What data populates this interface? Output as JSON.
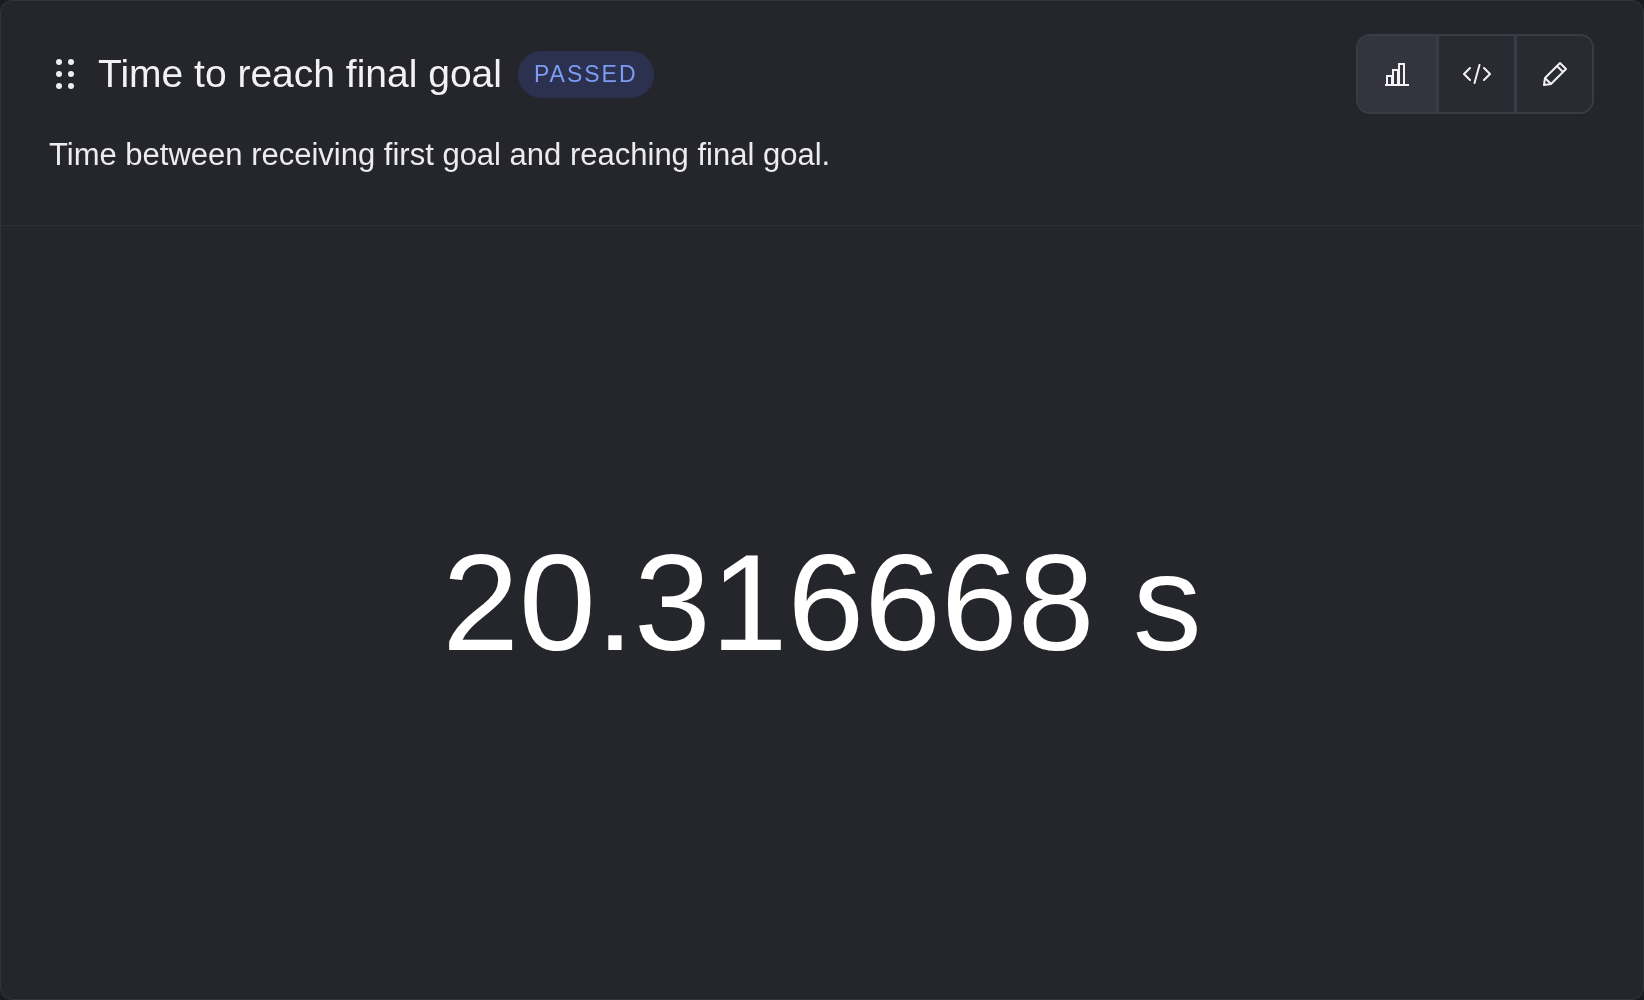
{
  "card": {
    "title": "Time to reach final goal",
    "status": {
      "label": "PASSED",
      "kind": "passed"
    },
    "description": "Time between receiving first goal and reaching final goal.",
    "view_buttons": [
      {
        "kind": "chart",
        "selected": true
      },
      {
        "kind": "code",
        "selected": false
      },
      {
        "kind": "edit",
        "selected": false
      }
    ],
    "value": "20.316668 s"
  }
}
